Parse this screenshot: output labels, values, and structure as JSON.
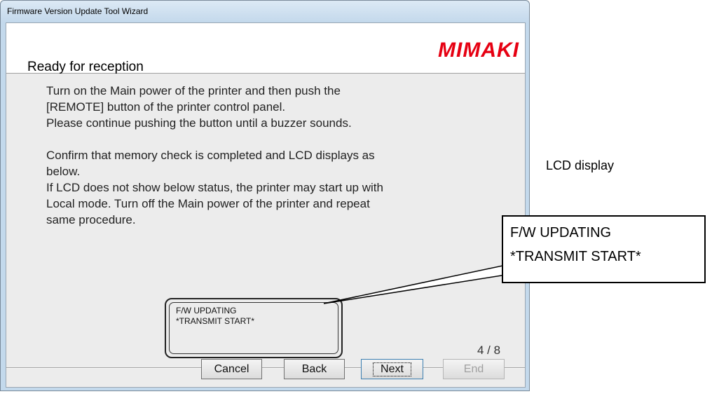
{
  "window": {
    "title": "Firmware Version Update Tool Wizard"
  },
  "header": {
    "heading": "Ready for reception",
    "logo": "MIMAKI"
  },
  "body": {
    "lines": [
      "Turn on the Main power of the printer and then push the",
      "[REMOTE] button of the printer control panel.",
      "Please continue pushing the button until a buzzer sounds.",
      "Confirm that memory check is completed and LCD displays as",
      "below.",
      "If LCD does not show below status, the printer may start up with",
      "Local mode. Turn off the Main power of the printer and repeat",
      "same procedure."
    ]
  },
  "lcd": {
    "line1": "F/W UPDATING",
    "line2": "*TRANSMIT START*"
  },
  "page_indicator": "4 / 8",
  "buttons": {
    "cancel": "Cancel",
    "back": "Back",
    "next": "Next",
    "end": "End"
  },
  "annotation": {
    "label": "LCD display",
    "callout_line1": "F/W UPDATING",
    "callout_line2": "*TRANSMIT START*"
  },
  "colors": {
    "logo": "#e60012",
    "frame": "#c3d9ec",
    "client_bg": "#ececec"
  }
}
